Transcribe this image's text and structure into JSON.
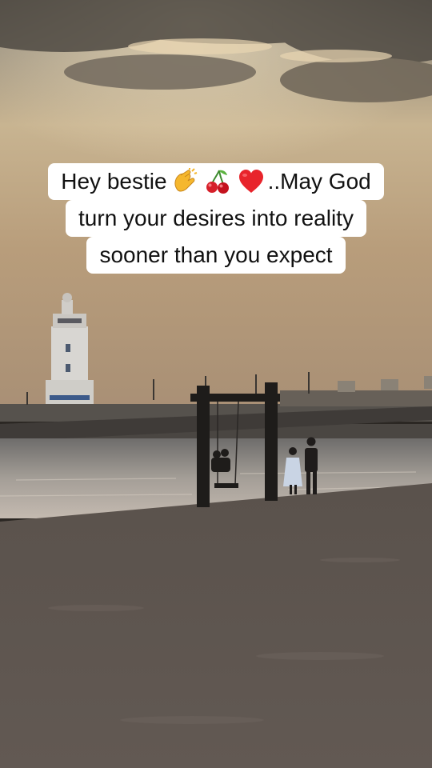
{
  "caption": {
    "line1_text": "Hey bestie",
    "line1_emojis": [
      "clapping-hands",
      "cherries",
      "red-heart"
    ],
    "line1_tail": "..May God",
    "line2": "turn your desires into reality",
    "line3": "sooner than you expect"
  },
  "colors": {
    "caption_bg": "#ffffff",
    "caption_text": "#111111"
  }
}
